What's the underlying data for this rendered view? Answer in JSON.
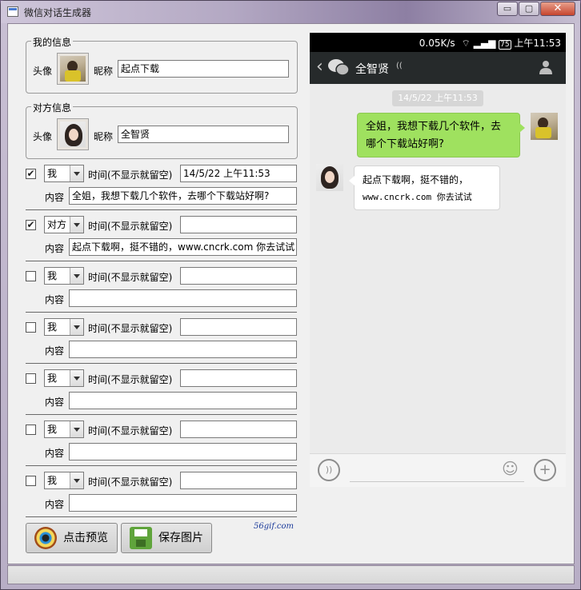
{
  "window": {
    "title": "微信对话生成器",
    "minimize": "▭",
    "restore": "▢",
    "close": "✕"
  },
  "my_info": {
    "legend": "我的信息",
    "avatar_label": "头像",
    "nick_label": "昵称",
    "nickname": "起点下载"
  },
  "peer_info": {
    "legend": "对方信息",
    "avatar_label": "头像",
    "nick_label": "昵称",
    "nickname": "全智贤"
  },
  "time_label": "时间(不显示就留空)",
  "content_label": "内容",
  "rows": [
    {
      "checked": "✔",
      "speaker": "我",
      "time": "14/5/22 上午11:53",
      "content": "全姐，我想下载几个软件，去哪个下载站好啊?"
    },
    {
      "checked": "✔",
      "speaker": "对方",
      "time": "",
      "content": "起点下载啊，挺不错的，www.cncrk.com 你去试试"
    },
    {
      "checked": "",
      "speaker": "我",
      "time": "",
      "content": ""
    },
    {
      "checked": "",
      "speaker": "我",
      "time": "",
      "content": ""
    },
    {
      "checked": "",
      "speaker": "我",
      "time": "",
      "content": ""
    },
    {
      "checked": "",
      "speaker": "我",
      "time": "",
      "content": ""
    },
    {
      "checked": "",
      "speaker": "我",
      "time": "",
      "content": ""
    }
  ],
  "buttons": {
    "preview": "点击预览",
    "save": "保存图片"
  },
  "watermark": "56gif.com",
  "phone": {
    "status": {
      "speed": "0.05K/s",
      "battery": "75",
      "clock": "上午11:53"
    },
    "nav": {
      "back": "‹",
      "name": "全智贤",
      "ear_icon": "((",
      "person_icon": "person-icon"
    },
    "timestamp": "14/5/22 上午11:53",
    "msg_me_line1": "全姐，我想下载几个软件，去",
    "msg_me_line2": "哪个下载站好啊?",
    "msg_peer_line1": "起点下载啊，挺不错的，",
    "msg_peer_line2": "www.cncrk.com 你去试试",
    "voice": "))",
    "smile": "☺",
    "plus": "+"
  }
}
